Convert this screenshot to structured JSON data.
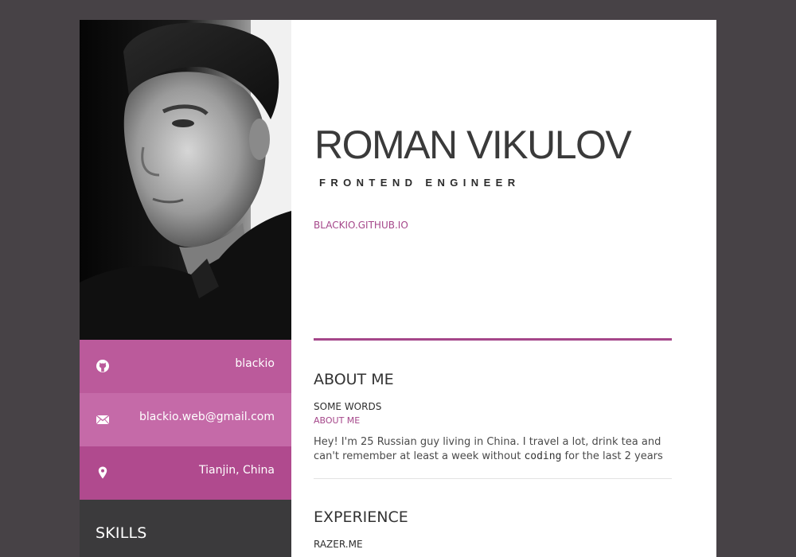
{
  "sidebar": {
    "contacts": [
      {
        "icon": "github-icon",
        "label": "blackio"
      },
      {
        "icon": "mail-icon",
        "label": "blackio.web@gmail.com"
      },
      {
        "icon": "location-pin-icon",
        "label": "Tianjin, China"
      }
    ],
    "skills_title": "SKILLS"
  },
  "header": {
    "name": "ROMAN VIKULOV",
    "title": "FRONTEND ENGINEER",
    "website": "BLACKIO.GITHUB.IO"
  },
  "about": {
    "heading": "ABOUT ME",
    "subheading": "SOME WORDS",
    "sublabel": "ABOUT ME",
    "text_before": "Hey! I'm 25 Russian guy living in China. I travel a lot, drink tea and can't remember at least a week without ",
    "code_word": "coding",
    "text_after": " for the last 2 years"
  },
  "experience": {
    "heading": "EXPERIENCE",
    "first_company": "RAZER.ME"
  },
  "colors": {
    "background": "#474246",
    "accent": "#a5478a",
    "contact_github": "#bb5a9b",
    "contact_mail": "#c56aa8",
    "contact_location": "#b04a8e",
    "sidebar_dark": "#3b3a3c"
  }
}
